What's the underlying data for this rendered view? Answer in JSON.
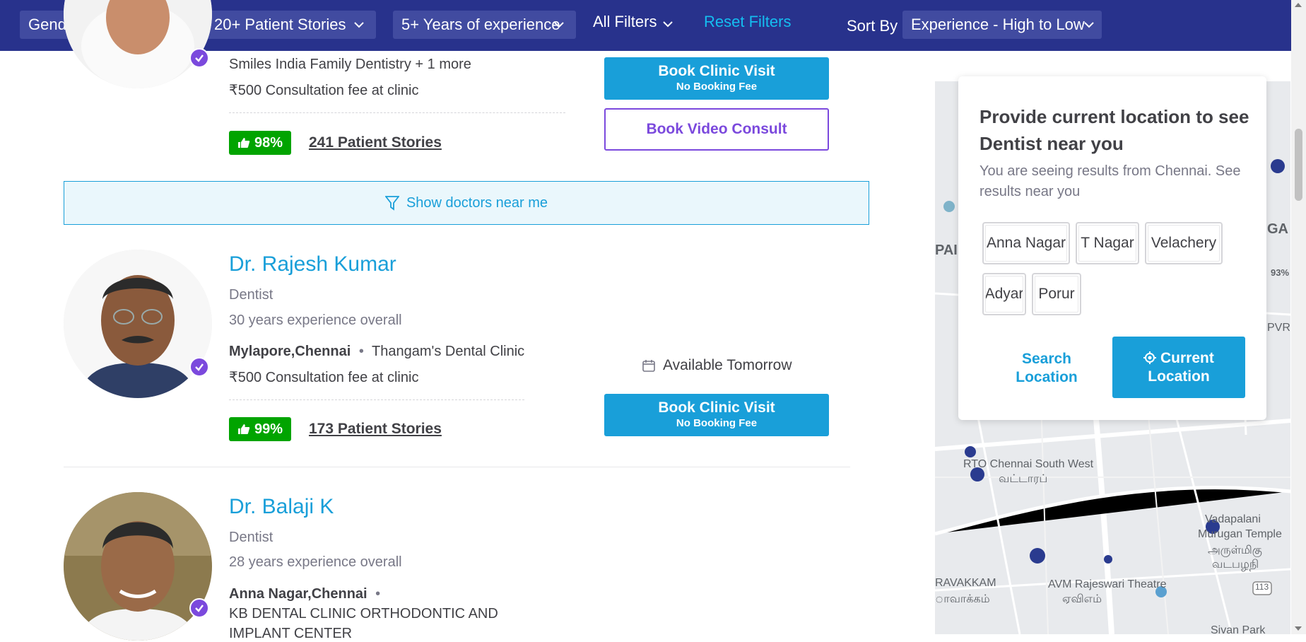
{
  "filters": {
    "gender": "Gender",
    "patient_stories": "20+ Patient Stories",
    "experience": "5+ Years of experience",
    "all_filters": "All Filters",
    "reset": "Reset Filters",
    "sort_by_label": "Sort By",
    "sort_value": "Experience - High to Low"
  },
  "doctor_prev": {
    "clinic": "Smiles India Family Dentistry + 1 more",
    "fee": "₹500 Consultation fee at clinic",
    "rating": "98%",
    "stories": "241 Patient Stories",
    "book_line1": "Book Clinic Visit",
    "book_line2": "No Booking Fee",
    "video": "Book Video Consult"
  },
  "near_banner": "Show doctors near me",
  "doctor1": {
    "name": "Dr. Rajesh Kumar",
    "specialty": "Dentist",
    "experience": "30 years experience overall",
    "locality": "Mylapore,Chennai",
    "clinic": "Thangam's Dental Clinic",
    "fee": "₹500 Consultation fee at clinic",
    "rating": "99%",
    "stories": "173 Patient Stories",
    "availability": "Available Tomorrow",
    "book_line1": "Book Clinic Visit",
    "book_line2": "No Booking Fee"
  },
  "doctor2": {
    "name": "Dr. Balaji K",
    "specialty": "Dentist",
    "experience": "28 years experience overall",
    "locality": "Anna Nagar,Chennai",
    "clinic_line1": "KB DENTAL CLINIC ORTHODONTIC AND",
    "clinic_line2": "IMPLANT CENTER"
  },
  "location_popup": {
    "title": "Provide current location to see Dentist near you",
    "subtitle": "You are seeing results from Chennai. See results near you",
    "chips": [
      "Anna Nagar",
      "T Nagar",
      "Velachery",
      "Adyar",
      "Porur"
    ],
    "search": "Search Location",
    "current": "Current Location"
  },
  "map": {
    "labels": [
      "RTO Chennai South West",
      "வட்டாரப்",
      "AVM Rajeswari Theatre",
      "Vadapalani",
      "Murugan Temple",
      "அருள்மிகு",
      "வடபழநி",
      "RAVAKKAM",
      "ாவாக்கம்",
      "ஏவிஎம்",
      "113",
      "Sivan Park",
      "93%",
      "PVR",
      "GA",
      "PAI"
    ]
  },
  "colors": {
    "nav_bg": "#28328c",
    "brand_blue": "#199fd9",
    "rating_green": "#01a400",
    "verified_purple": "#7b49dd"
  }
}
